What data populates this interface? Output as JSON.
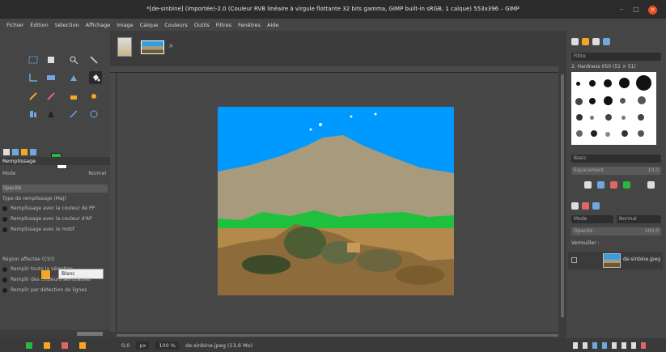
{
  "window": {
    "title": "*[de-sinbine] (importée)-2.0 (Couleur RVB linéaire à virgule flottante 32 bits gamma, GIMP built-in sRGB, 1 calque) 553x396 – GIMP"
  },
  "menubar": {
    "items": [
      "Fichier",
      "Édition",
      "Sélection",
      "Affichage",
      "Image",
      "Calque",
      "Couleurs",
      "Outils",
      "Filtres",
      "Fenêtres",
      "Aide"
    ]
  },
  "tool_options": {
    "panel_title": "Remplissage",
    "mode_label": "Mode",
    "mode_value": "Normal",
    "opacity_label": "Opacité",
    "fill_type_label": "Type de remplissage (Maj)",
    "fill_types": [
      "Remplissage avec la couleur de PP",
      "Remplissage avec la couleur d'AP",
      "Remplissage avec le motif"
    ],
    "pattern_label": "Blanc",
    "area_label": "Région affectée (Ctrl)",
    "areas": [
      "Remplir toute la sélection",
      "Remplir des couleurs semblables",
      "Remplir par détection de lignes"
    ]
  },
  "statusbar": {
    "pointer": "0,0",
    "unit": "px",
    "zoom": "100 %",
    "message": "de-sinbine.jpeg (13,6 Mo)"
  },
  "right_panel": {
    "filter_placeholder": "Filtre",
    "brush_name": "2. Hardness 050 (51 × 51)",
    "brush_category": "Basic",
    "spacing_label": "Espacement",
    "spacing_value": "10,0",
    "layers_mode_label": "Mode",
    "layers_mode_value": "Normal",
    "opacity_label": "Opacité",
    "opacity_value": "100,0",
    "lock_label": "Verrouiller :",
    "layer_name": "de-sinbine.jpeg"
  },
  "colors": {
    "foreground": "#27b83c",
    "background": "#ffffff",
    "accent_close": "#e95420"
  }
}
